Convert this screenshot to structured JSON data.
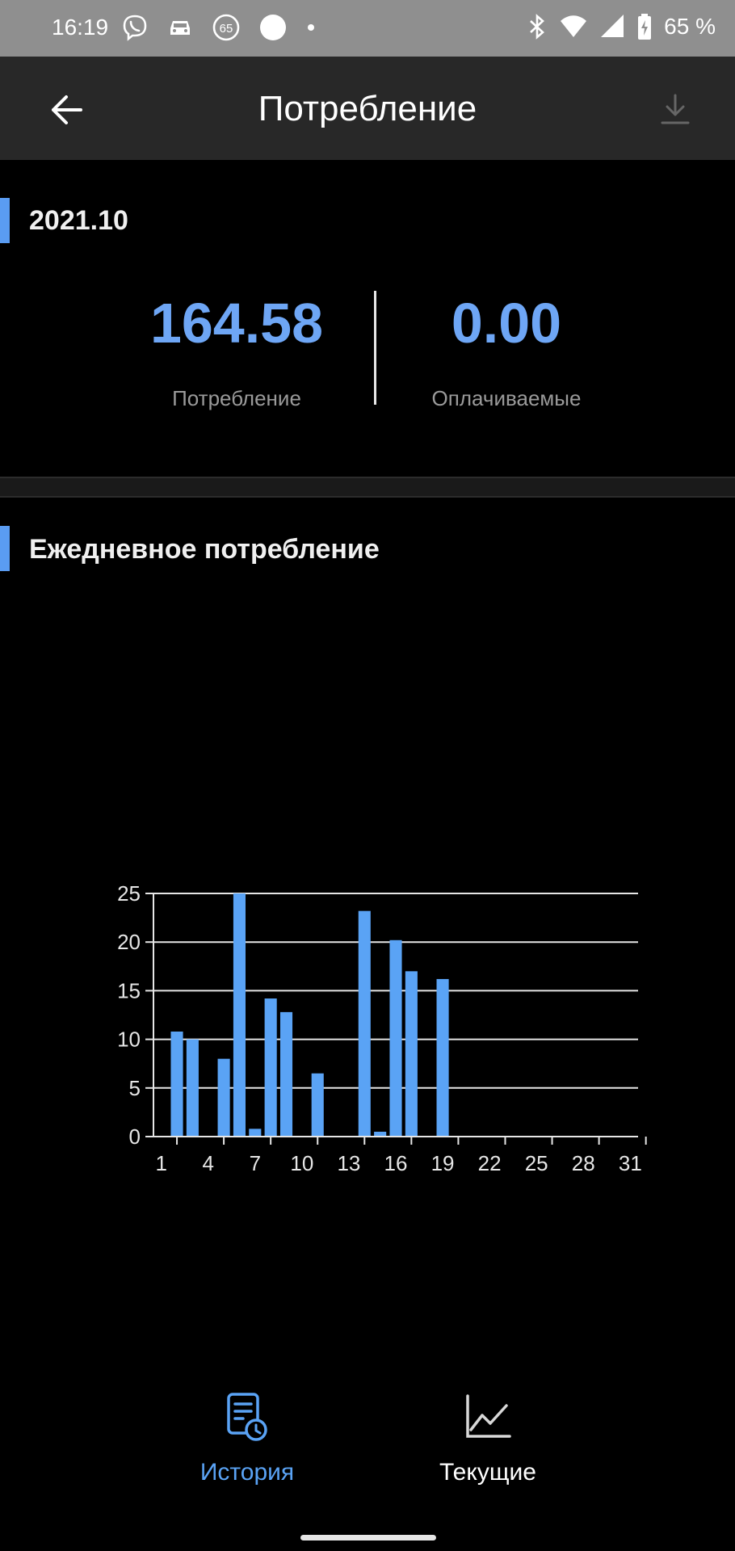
{
  "status_bar": {
    "time": "16:19",
    "battery_text": "65 %",
    "left_icons": [
      "viber-icon",
      "car-icon",
      "speed-65-icon",
      "circle-icon",
      "dot-icon"
    ],
    "right_icons": [
      "bluetooth-icon",
      "wifi-icon",
      "signal-icon",
      "battery-charging-icon"
    ],
    "speed_badge": "65"
  },
  "app_bar": {
    "title": "Потребление",
    "back_icon": "arrow-left-icon",
    "download_icon": "download-icon"
  },
  "summary": {
    "period": "2021.10",
    "consumption_value": "164.58",
    "consumption_label": "Потребление",
    "billable_value": "0.00",
    "billable_label": "Оплачиваемые"
  },
  "daily": {
    "title": "Ежедневное потребление"
  },
  "chart_data": {
    "type": "bar",
    "title": "",
    "xlabel": "",
    "ylabel": "",
    "ylim": [
      0,
      25
    ],
    "y_ticks": [
      "0",
      "5",
      "10",
      "15",
      "20",
      "25"
    ],
    "x_ticks": [
      "1",
      "4",
      "7",
      "10",
      "13",
      "16",
      "19",
      "22",
      "25",
      "28",
      "31"
    ],
    "grid": true,
    "color": "#5aa3f5",
    "categories": [
      1,
      2,
      3,
      4,
      5,
      6,
      7,
      8,
      9,
      10,
      11,
      12,
      13,
      14,
      15,
      16,
      17,
      18,
      19,
      20,
      21,
      22,
      23,
      24,
      25,
      26,
      27,
      28,
      29,
      30,
      31
    ],
    "values": [
      0,
      10.8,
      10,
      0,
      8,
      25,
      0.8,
      14.2,
      12.8,
      0,
      6.5,
      0,
      0,
      23.2,
      0.5,
      20.2,
      17,
      0,
      16.2,
      0,
      0,
      0,
      0,
      0,
      0,
      0,
      0,
      0,
      0,
      0,
      0
    ]
  },
  "bottom_nav": {
    "items": [
      {
        "label": "История",
        "icon": "history-icon",
        "active": true
      },
      {
        "label": "Текущие",
        "icon": "line-chart-icon",
        "active": false
      }
    ],
    "active_color": "#5aa3f5",
    "inactive_color": "#ffffff"
  }
}
